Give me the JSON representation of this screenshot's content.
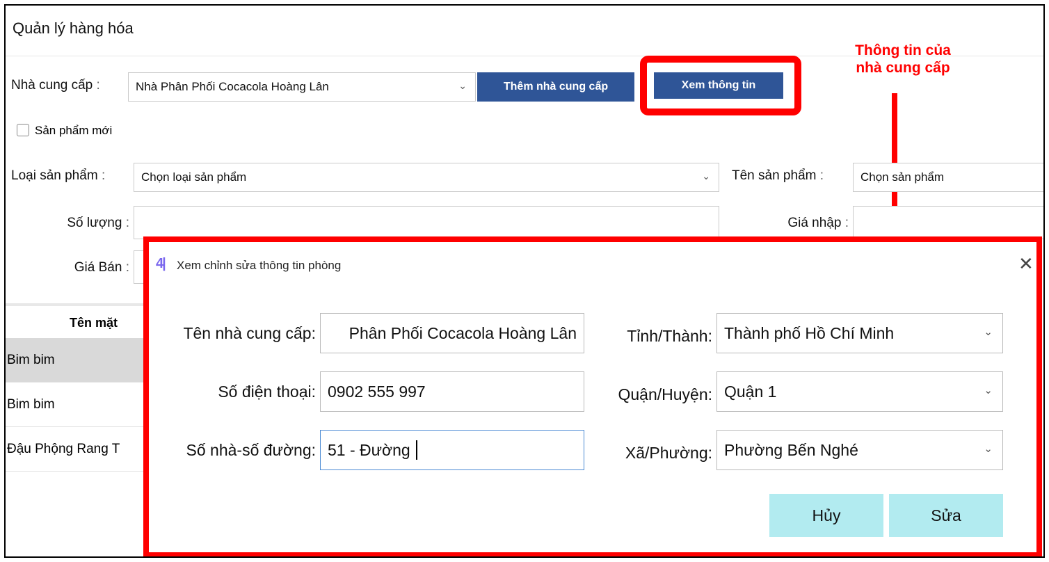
{
  "window": {
    "title": "Quản lý hàng hóa"
  },
  "form": {
    "supplier_label": "Nhà cung cấp",
    "supplier_value": "Nhà Phân Phối Cocacola Hoàng Lân",
    "add_supplier_button": "Thêm nhà cung cấp",
    "view_info_button": "Xem thông tin",
    "new_product_label": "Sản phẩm mới",
    "product_type_label": "Loại sản phẩm",
    "product_type_value": "Chọn loại sản phẩm",
    "product_name_label": "Tên sản phẩm",
    "product_name_value": "Chọn sản phẩm",
    "quantity_label": "Số lượng",
    "import_price_label": "Giá nhập",
    "sell_price_label": "Giá Bán",
    "colon": ":"
  },
  "grid": {
    "header": "Tên mặt",
    "rows": [
      "Bim bim",
      "Bim bim",
      "Đậu Phộng Rang T"
    ]
  },
  "annotation": {
    "text_line1": "Thông tin của",
    "text_line2": "nhà cung cấp",
    "color": "#ff0000"
  },
  "dialog": {
    "title": "Xem chỉnh sửa thông tin phòng",
    "logo": "4|",
    "close": "✕",
    "supplier_name_label": "Tên nhà cung cấp:",
    "supplier_name_value": "Phân Phối Cocacola Hoàng Lân",
    "phone_label": "Số điện thoại:",
    "phone_value": "0902 555 997",
    "address_label": "Số nhà-số đường:",
    "address_value": "51 - Đường",
    "province_label": "Tỉnh/Thành:",
    "province_value": "Thành phố Hồ Chí Minh",
    "district_label": "Quận/Huyện:",
    "district_value": "Quận 1",
    "ward_label": "Xã/Phường:",
    "ward_value": "Phường Bến Nghé",
    "cancel_button": "Hủy",
    "edit_button": "Sửa"
  },
  "icons": {
    "chevron": "chevron-down-icon",
    "close": "close-icon"
  },
  "colors": {
    "primary_button": "#2f5597",
    "dialog_button": "#b2ebf0",
    "highlight": "#ff0000"
  }
}
